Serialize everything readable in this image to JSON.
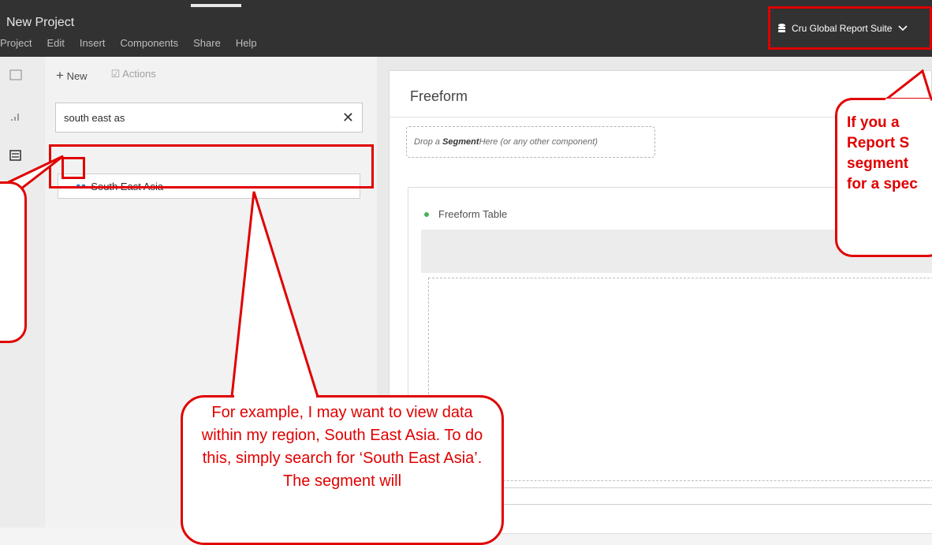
{
  "header": {
    "project_title": "New Project",
    "menu": [
      "Project",
      "Edit",
      "Insert",
      "Components",
      "Share",
      "Help"
    ],
    "report_suite": "Cru Global Report Suite",
    "report_suite_icon": "database-icon",
    "dropdown_icon": "chevron-down-icon"
  },
  "rail": {
    "icons": [
      "panel-icon",
      "visualization-icon",
      "components-icon"
    ]
  },
  "components_panel": {
    "new_label": "New",
    "actions_label": "Actions",
    "search": {
      "value": "south east as",
      "clear_icon": "close-icon"
    },
    "results": [
      {
        "icon": "segment-icon",
        "label": "South East Asia"
      }
    ]
  },
  "workspace": {
    "panel_title": "Freeform",
    "dropzone": {
      "prefix": "Drop a ",
      "bold": "Segment",
      "suffix": " Here (or any other component)"
    },
    "table_title": "Freeform Table"
  },
  "annotations": {
    "main": "For example, I may want to view data within my region, South East Asia. To do this, simply search for ‘South East Asia’. The segment will",
    "right": "If you a\nReport S\nsegment\nfor a spec",
    "color": "#e00000"
  }
}
